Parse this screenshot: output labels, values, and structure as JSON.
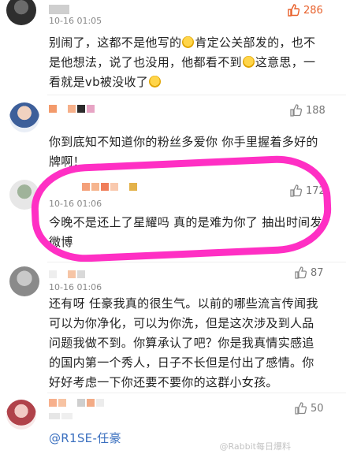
{
  "comments": [
    {
      "time": "10-16 01:05",
      "likes": "286",
      "liked": true,
      "text_lines": [
        "别闹了，这都不是他写的",
        "肯定公关部发的，也不",
        "是他想法，说了也没用，他都看不到",
        "这意思，一",
        "看就是vb被没收了"
      ]
    },
    {
      "likes": "188",
      "text_lines": [
        "你到底知不知道你的粉丝多爱你 你手里握着多好的",
        "牌啊！"
      ]
    },
    {
      "time": "10-16 01:06",
      "likes": "172",
      "text_lines": [
        "今晚不是还上了星耀吗 真的是难为你了 抽出时间发",
        "微博"
      ]
    },
    {
      "time": "10-16 01:06",
      "likes": "87",
      "text_lines": [
        "还有呀 任豪我真的很生气。以前的哪些流言传闻我",
        "可以为你净化，可以为你洗，但是这次涉及到人品",
        "问题我做不到。你算承认了吧？你是我真情实感追",
        "的国内第一个秀人，日子不长但是付出了感情。你",
        "好好考虑一下你还要不要你的这群小女孩。"
      ]
    },
    {
      "likes": "50",
      "text_lines": [
        "@R1SE-任豪"
      ]
    }
  ],
  "watermark": "@Rabbit每日爆料",
  "colors": {
    "accent_like": "#e8612c",
    "highlight": "#ff2fc4",
    "mention": "#3a6fbf"
  }
}
